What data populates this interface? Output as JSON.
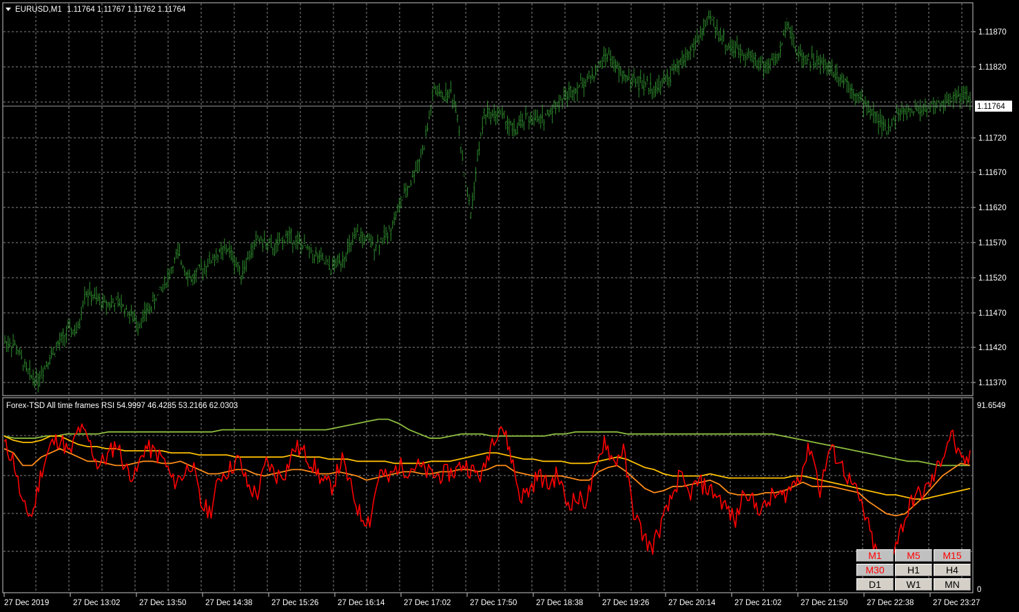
{
  "symbol_header": {
    "arrow": "triangle-down-icon",
    "symbol": "EURUSD,M1",
    "ohlc": "1.11764 1.11767 1.11762 1.11764"
  },
  "main_axis": {
    "labels": [
      "1.11870",
      "1.11820",
      "1.11720",
      "1.11670",
      "1.11620",
      "1.11570",
      "1.11520",
      "1.11470",
      "1.11420",
      "1.11370"
    ],
    "current_price": "1.11764"
  },
  "indicator": {
    "header": "Forex-TSD All time frames RSI 54.9997 46.4285 53.2166 62.0303",
    "scale_max": "91.6549",
    "scale_min": "0"
  },
  "time_axis": {
    "labels": [
      "27 Dec 2019",
      "27 Dec 13:02",
      "27 Dec 13:50",
      "27 Dec 14:38",
      "27 Dec 15:26",
      "27 Dec 16:14",
      "27 Dec 17:02",
      "27 Dec 17:50",
      "27 Dec 18:38",
      "27 Dec 19:26",
      "27 Dec 20:14",
      "27 Dec 21:02",
      "27 Dec 21:50",
      "27 Dec 22:38",
      "27 Dec 23:27"
    ]
  },
  "timeframe_buttons": [
    {
      "label": "M1",
      "color": "#ff0000"
    },
    {
      "label": "M5",
      "color": "#ff0000"
    },
    {
      "label": "M15",
      "color": "#ff0000"
    },
    {
      "label": "M30",
      "color": "#ff0000"
    },
    {
      "label": "H1",
      "color": "#000000"
    },
    {
      "label": "H4",
      "color": "#000000"
    },
    {
      "label": "D1",
      "color": "#000000"
    },
    {
      "label": "W1",
      "color": "#000000"
    },
    {
      "label": "MN",
      "color": "#000000"
    }
  ],
  "colors": {
    "background": "#000000",
    "grid": "#8a8a8a",
    "price_bars": "#2f8f2f",
    "rsi_m1": "#ff0000",
    "rsi_m5": "#ff8c1a",
    "rsi_m15": "#ffc000",
    "rsi_m30": "#8fbf3f"
  },
  "chart_data": [
    {
      "type": "line",
      "title": "EURUSD,M1",
      "ylim": [
        1.1135,
        1.119
      ],
      "x_index": [
        0,
        3,
        6,
        10,
        14,
        18,
        20,
        23,
        26,
        29,
        33,
        37,
        38,
        42,
        45,
        48,
        52,
        55,
        58,
        61,
        65,
        68,
        71,
        74,
        77,
        80,
        84,
        88,
        92,
        96,
        98,
        100,
        104,
        108,
        112,
        116,
        120,
        124,
        128,
        132,
        136,
        140,
        142,
        144,
        148,
        152,
        156,
        160,
        164,
        168,
        172,
        176,
        180,
        184,
        188,
        192,
        196,
        200,
        204,
        208,
        210,
        212,
        216,
        220,
        224,
        228,
        232,
        236,
        238,
        240
      ],
      "price": [
        1.11425,
        1.1143,
        1.1142,
        1.11395,
        1.1138,
        1.11372,
        1.1137,
        1.11385,
        1.114,
        1.11395,
        1.1141,
        1.1143,
        1.1144,
        1.1143,
        1.1148,
        1.11495,
        1.1147,
        1.11485,
        1.1148,
        1.11482,
        1.11492,
        1.1148,
        1.11475,
        1.1147,
        1.1146,
        1.1145,
        1.11455,
        1.1147,
        1.1149,
        1.11505,
        1.1152,
        1.1153,
        1.11548,
        1.1154,
        1.11515,
        1.1151,
        1.11525,
        1.1154,
        1.11548,
        1.1156,
        1.1154,
        1.1153,
        1.1152,
        1.11532,
        1.1155,
        1.1157,
        1.11555,
        1.11545,
        1.1156,
        1.11565,
        1.1157,
        1.1158,
        1.1156,
        1.11555,
        1.1155,
        1.1154,
        1.1153,
        1.1153,
        1.1154,
        1.1155,
        1.1156,
        1.11575,
        1.1156,
        1.11552,
        1.1156,
        1.11548,
        1.1156,
        1.11575,
        1.1159,
        1.1162
      ]
    },
    {
      "type": "line",
      "title": "Forex-TSD All time frames RSI",
      "ylim": [
        0,
        91.6549
      ],
      "series": [
        {
          "name": "M1",
          "color": "#ff0000",
          "values": [
            70,
            63,
            40,
            36,
            58,
            70,
            73,
            65,
            78,
            72,
            60,
            64,
            71,
            58,
            55,
            69,
            66,
            63,
            52,
            55,
            62,
            41,
            38,
            55,
            58,
            63,
            50,
            46,
            62,
            55,
            57,
            69,
            66,
            60,
            52,
            50,
            63,
            49,
            36,
            34,
            57,
            53,
            60,
            58,
            60,
            57,
            55,
            56,
            57,
            61,
            57,
            55,
            72,
            80,
            66,
            45,
            48,
            56,
            50,
            56,
            42,
            44,
            43,
            55,
            73,
            61,
            68,
            40,
            28,
            20,
            31,
            42,
            55,
            46,
            52,
            49,
            46,
            40,
            33,
            50,
            41,
            39,
            46,
            45,
            50,
            57,
            70,
            48,
            68,
            63,
            54,
            46,
            33,
            18,
            13,
            22,
            34,
            45,
            47,
            53,
            64,
            76,
            61,
            63
          ]
        },
        {
          "name": "M5",
          "color": "#ff8c1a",
          "values": [
            68,
            66,
            60,
            60,
            64,
            66,
            68,
            66,
            64,
            62,
            62,
            61,
            60,
            60,
            61,
            62,
            62,
            61,
            61,
            62,
            60,
            58,
            56,
            56,
            57,
            58,
            58,
            56,
            55,
            56,
            57,
            58,
            58,
            57,
            56,
            56,
            57,
            56,
            55,
            53,
            54,
            55,
            56,
            57,
            57,
            56,
            56,
            57,
            57,
            58,
            58,
            57,
            58,
            60,
            60,
            57,
            56,
            55,
            55,
            55,
            55,
            54,
            53,
            53,
            57,
            59,
            60,
            57,
            53,
            49,
            47,
            48,
            50,
            50,
            51,
            52,
            53,
            51,
            47,
            46,
            46,
            46,
            47,
            47,
            48,
            50,
            52,
            50,
            50,
            50,
            49,
            48,
            47,
            43,
            40,
            37,
            36,
            37,
            41,
            45,
            50,
            55,
            58,
            61,
            60
          ]
        },
        {
          "name": "M15",
          "color": "#ffc000",
          "values": [
            74,
            72,
            71,
            71,
            72,
            74,
            74,
            72,
            70,
            69,
            69,
            68,
            68,
            67,
            67,
            67,
            67,
            67,
            66,
            66,
            66,
            65,
            65,
            65,
            65,
            64,
            64,
            64,
            64,
            64,
            64,
            65,
            64,
            64,
            64,
            63,
            63,
            63,
            62,
            62,
            62,
            62,
            61,
            61,
            61,
            61,
            62,
            62,
            62,
            63,
            64,
            65,
            66,
            66,
            65,
            64,
            63,
            63,
            62,
            62,
            62,
            61,
            61,
            61,
            62,
            63,
            64,
            63,
            61,
            59,
            58,
            56,
            55,
            55,
            55,
            55,
            56,
            55,
            54,
            54,
            54,
            54,
            54,
            54,
            54,
            55,
            55,
            54,
            53,
            52,
            51,
            50,
            49,
            48,
            47,
            46,
            46,
            45,
            44,
            44,
            45,
            46,
            47,
            48,
            49
          ]
        },
        {
          "name": "M30",
          "color": "#8fbf3f",
          "values": [
            74,
            73,
            73,
            73,
            74,
            74,
            75,
            75,
            75,
            75,
            76,
            76,
            76,
            76,
            76,
            76,
            76,
            76,
            76,
            76,
            76,
            77,
            77,
            77,
            77,
            77,
            77,
            77,
            77,
            77,
            77,
            77,
            78,
            79,
            80,
            81,
            82,
            82,
            80,
            77,
            75,
            73,
            73,
            74,
            75,
            75,
            75,
            74,
            74,
            74,
            74,
            74,
            74,
            75,
            75,
            76,
            76,
            76,
            76,
            76,
            75,
            75,
            75,
            75,
            75,
            75,
            75,
            75,
            75,
            75,
            75,
            75,
            75,
            75,
            75,
            74,
            73,
            72,
            71,
            70,
            69,
            68,
            67,
            66,
            65,
            64,
            63,
            62,
            62,
            61,
            60,
            60,
            60,
            60
          ]
        }
      ]
    }
  ]
}
